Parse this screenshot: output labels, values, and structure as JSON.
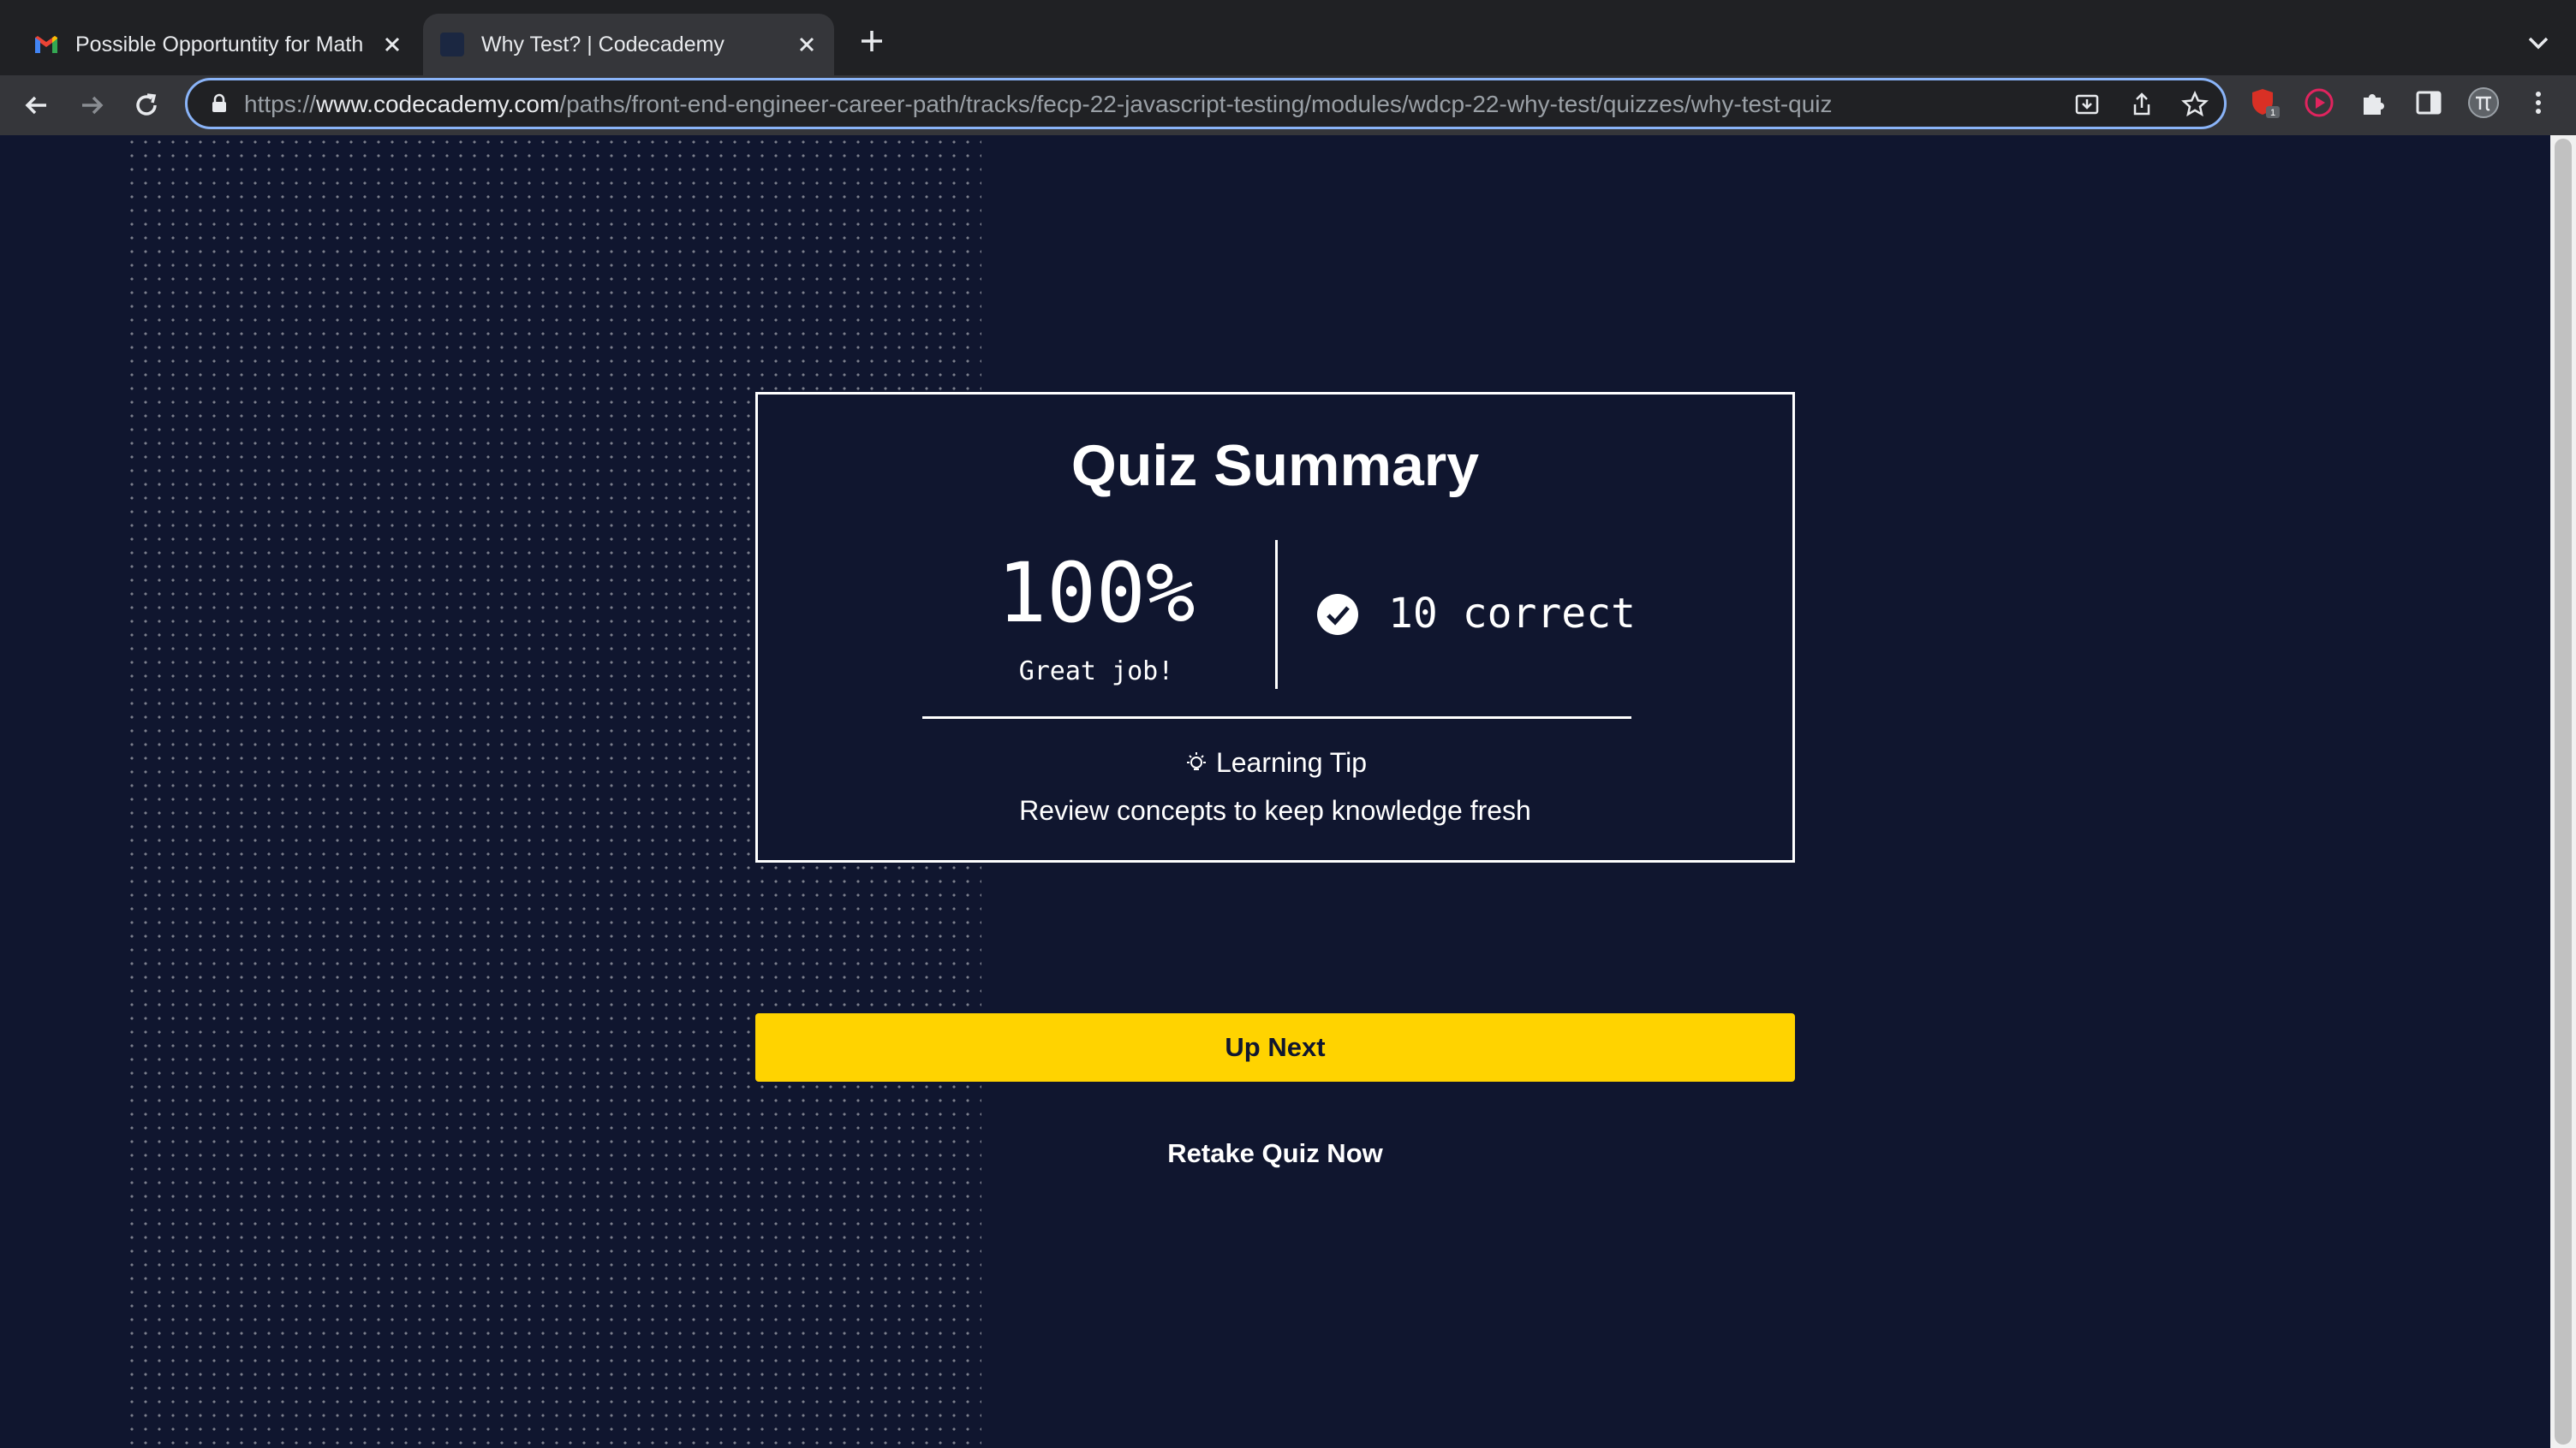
{
  "browser": {
    "tabs": [
      {
        "title": "Possible Opportuntity for Math",
        "active": false
      },
      {
        "title": "Why Test? | Codecademy",
        "active": true
      }
    ],
    "url_scheme": "https://",
    "url_host": "www.codecademy.com",
    "url_path": "/paths/front-end-engineer-career-path/tracks/fecp-22-javascript-testing/modules/wdcp-22-why-test/quizzes/why-test-quiz",
    "extension_badge": "1"
  },
  "quiz_summary": {
    "title": "Quiz Summary",
    "score": "100%",
    "score_caption": "Great job!",
    "correct_text": "10 correct",
    "tip_label": "Learning Tip",
    "tip_text": "Review concepts to keep knowledge fresh"
  },
  "actions": {
    "up_next_label": "Up Next",
    "retake_label": "Retake Quiz Now"
  },
  "colors": {
    "page_bg": "#10162f",
    "primary_button": "#ffd300",
    "text": "#ffffff"
  }
}
